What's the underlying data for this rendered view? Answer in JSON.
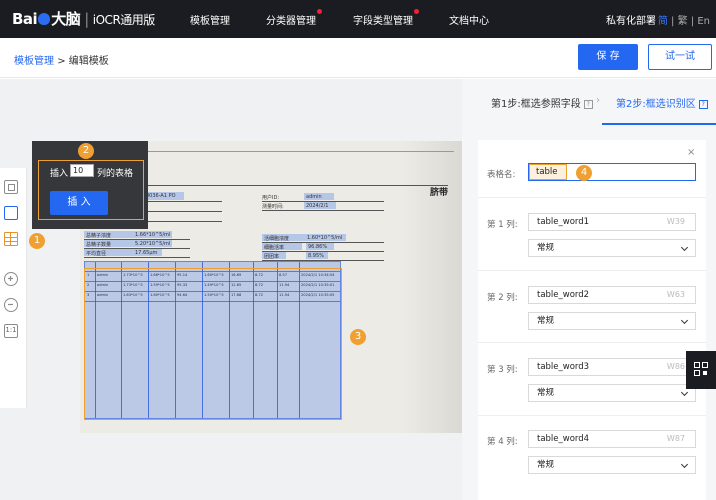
{
  "nav": {
    "logo_left": "Bai",
    "logo_right": "大脑",
    "product": "iOCR通用版",
    "items": [
      {
        "label": "模板管理",
        "dot": false
      },
      {
        "label": "分类器管理",
        "dot": true
      },
      {
        "label": "字段类型管理",
        "dot": true
      },
      {
        "label": "文档中心",
        "dot": false
      }
    ],
    "deploy": "私有化部署",
    "lang": [
      "简",
      "繁",
      "En"
    ]
  },
  "breadcrumb": {
    "parent": "模板管理",
    "separator": ">",
    "current": "编辑模板"
  },
  "actions": {
    "save": "保 存",
    "test": "试一试"
  },
  "steps": {
    "step1": "第1步:框选参照字段",
    "step2": "第2步:框选识别区",
    "help": "?"
  },
  "popup": {
    "insert_prefix": "插入",
    "columns_value": "10",
    "insert_suffix": "列的表格",
    "insert_button": "插 入"
  },
  "badges": [
    "1",
    "2",
    "3",
    "4"
  ],
  "form": {
    "table_name_label": "表格名:",
    "table_name_value": "table",
    "columns": [
      {
        "label": "第 1 列:",
        "value": "table_word1",
        "hint": "W39",
        "type": "常规"
      },
      {
        "label": "第 2 列:",
        "value": "table_word2",
        "hint": "W63",
        "type": "常规"
      },
      {
        "label": "第 3 列:",
        "value": "table_word3",
        "hint": "W86",
        "type": "常规"
      },
      {
        "label": "第 4 列:",
        "value": "table_word4",
        "hint": "W87",
        "type": "常规"
      }
    ],
    "close": "×"
  },
  "document": {
    "title_right": "脐带",
    "fields": [
      "0036-A1 PO",
      "用户ID:",
      "admin",
      "测量时间:",
      "2024/2/1",
      "总精子浓度",
      "1.66*10^5/ml",
      "总精子数量",
      "5.20*10^5/ml",
      "平均直径",
      "17.65μm",
      "活细胞浓度",
      "1.60*10^5/ml",
      "细胞活率",
      "96.86%",
      "团团率",
      "8.95%"
    ],
    "rows": [
      [
        "1",
        "admin",
        "1.73*10^5",
        "1.66*10^5",
        "95.14",
        "1.60*10^5",
        "16.69",
        "8.72",
        "8.57",
        "2024/2/1 10:34:54"
      ],
      [
        "2",
        "admin",
        "1.73*10^5",
        "1.59*10^5",
        "95.33",
        "1.49*10^5",
        "12.65",
        "8.72",
        "11.94",
        "2024/2/1 10:35:01"
      ],
      [
        "3",
        "admin",
        "1.63*10^5",
        "1.60*10^5",
        "94.64",
        "1.50*10^5",
        "17.68",
        "8.72",
        "11.54",
        "2024/2/1 10:35:05"
      ]
    ]
  }
}
